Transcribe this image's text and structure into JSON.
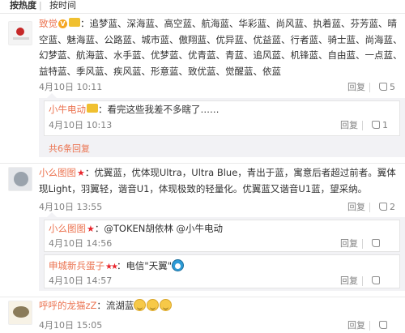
{
  "sort": {
    "hot": "按热度",
    "divider": "|",
    "time": "按时间"
  },
  "reply_label": "回复",
  "comments": [
    {
      "user": "致觉",
      "sep": "：",
      "body": "追梦蓝、深海蓝、高空蓝、航海蓝、华彩蓝、尚风蓝、执着蓝、芬芳蓝、晴空蓝、魅海蓝、公路蓝、城市蓝、傲翔蓝、优异蓝、优益蓝、行者蓝、骑士蓝、尚海蓝、幻梦蓝、航海蓝、水手蓝、优梦蓝、优青蓝、青蓝、追风蓝、机锋蓝、自由蓝、一点蓝、益特蓝、季风蓝、疾风蓝、形意蓝、致优蓝、觉醒蓝、依蓝",
      "time": "4月10日 10:11",
      "likes": "5",
      "replies": [
        {
          "user": "小牛电动",
          "sep": "：",
          "body": "看完这些我差不多瞎了……",
          "time": "4月10日 10:13",
          "likes": "1"
        }
      ],
      "more": "共6条回复"
    },
    {
      "user": "小么图图",
      "sep": "：",
      "body": "优翼蓝，优体现Ultra，Ultra Blue，青出于蓝，寓意后者超过前者。翼体现Light，羽翼轻，谐音U1，体现极致的轻量化。优翼蓝又谐音U1蓝，望采纳。",
      "time": "4月10日 13:55",
      "likes": "2",
      "replies": [
        {
          "user": "小么图图",
          "sep": "：",
          "body": "@TOKEN胡依林 @小牛电动",
          "time": "4月10日 14:56",
          "likes": ""
        },
        {
          "user": "申城新兵蛋子",
          "sep": "：",
          "body": "电信\"天翼\"",
          "time": "4月10日 14:57",
          "likes": ""
        }
      ]
    },
    {
      "user": "呼呼的龙猫zZ",
      "sep": "：",
      "body": "流湖蓝",
      "time": "4月10日 15:05",
      "likes": ""
    }
  ]
}
